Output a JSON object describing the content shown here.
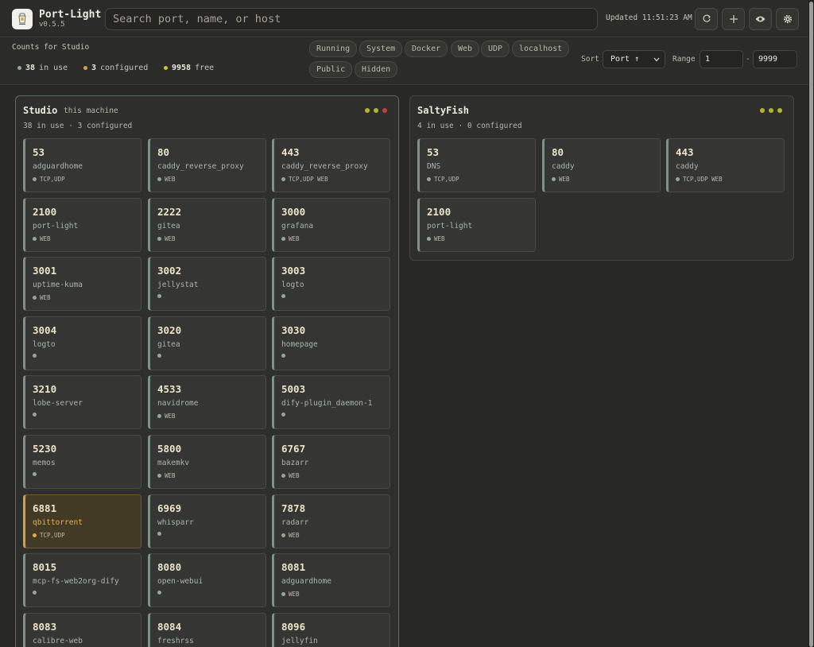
{
  "app": {
    "name": "Port-Light",
    "version": "v0.5.5"
  },
  "search": {
    "placeholder": "Search port, name, or host"
  },
  "updated": "Updated 11:51:23 AM",
  "toolbar": {
    "icons": [
      "refresh-icon",
      "plus-icon",
      "eye-icon",
      "gear-icon"
    ]
  },
  "counts": {
    "title": "Counts for Studio",
    "in_use_num": "38",
    "in_use_label": "in use",
    "configured_num": "3",
    "configured_label": "configured",
    "free_num": "9958",
    "free_label": "free"
  },
  "filters": [
    "Running",
    "System",
    "Docker",
    "Web",
    "UDP",
    "localhost",
    "Public",
    "Hidden"
  ],
  "sort": {
    "label": "Sort",
    "value": "Port ↑"
  },
  "range": {
    "label": "Range",
    "from": "1",
    "sep": "-",
    "to": "9999"
  },
  "colors": {
    "in_use": "#8fa89a",
    "configured": "#d6a33a",
    "free": "#c8c43a",
    "warning": "#d6a33a"
  },
  "hosts": [
    {
      "name": "Studio",
      "sub": "this machine",
      "meta": "38 in use · 3 configured",
      "status_dots": [
        "#b5b531",
        "#b5b531",
        "#b8453a"
      ],
      "ports": [
        {
          "port": "53",
          "name": "adguardhome",
          "tags": "TCP,UDP"
        },
        {
          "port": "80",
          "name": "caddy_reverse_proxy",
          "tags": "WEB"
        },
        {
          "port": "443",
          "name": "caddy_reverse_proxy",
          "tags": "TCP,UDP WEB"
        },
        {
          "port": "2100",
          "name": "port-light",
          "tags": "WEB"
        },
        {
          "port": "2222",
          "name": "gitea",
          "tags": "WEB"
        },
        {
          "port": "3000",
          "name": "grafana",
          "tags": "WEB"
        },
        {
          "port": "3001",
          "name": "uptime-kuma",
          "tags": "WEB"
        },
        {
          "port": "3002",
          "name": "jellystat",
          "tags": ""
        },
        {
          "port": "3003",
          "name": "logto",
          "tags": ""
        },
        {
          "port": "3004",
          "name": "logto",
          "tags": ""
        },
        {
          "port": "3020",
          "name": "gitea",
          "tags": ""
        },
        {
          "port": "3030",
          "name": "homepage",
          "tags": ""
        },
        {
          "port": "3210",
          "name": "lobe-server",
          "tags": ""
        },
        {
          "port": "4533",
          "name": "navidrome",
          "tags": "WEB"
        },
        {
          "port": "5003",
          "name": "dify-plugin_daemon-1",
          "tags": ""
        },
        {
          "port": "5230",
          "name": "memos",
          "tags": ""
        },
        {
          "port": "5800",
          "name": "makemkv",
          "tags": "WEB"
        },
        {
          "port": "6767",
          "name": "bazarr",
          "tags": "WEB"
        },
        {
          "port": "6881",
          "name": "qbittorrent",
          "tags": "TCP,UDP",
          "warning": true
        },
        {
          "port": "6969",
          "name": "whisparr",
          "tags": ""
        },
        {
          "port": "7878",
          "name": "radarr",
          "tags": "WEB"
        },
        {
          "port": "8015",
          "name": "mcp-fs-web2org-dify",
          "tags": ""
        },
        {
          "port": "8080",
          "name": "open-webui",
          "tags": ""
        },
        {
          "port": "8081",
          "name": "adguardhome",
          "tags": "WEB"
        },
        {
          "port": "8083",
          "name": "calibre-web",
          "tags": ""
        },
        {
          "port": "8084",
          "name": "freshrss",
          "tags": ""
        },
        {
          "port": "8096",
          "name": "jellyfin",
          "tags": ""
        }
      ]
    },
    {
      "name": "SaltyFish",
      "sub": "",
      "meta": "4 in use · 0 configured",
      "status_dots": [
        "#b5b531",
        "#b5b531",
        "#b5b531"
      ],
      "ports": [
        {
          "port": "53",
          "name": "DNS",
          "tags": "TCP,UDP"
        },
        {
          "port": "80",
          "name": "caddy",
          "tags": "WEB"
        },
        {
          "port": "443",
          "name": "caddy",
          "tags": "TCP,UDP WEB"
        },
        {
          "port": "2100",
          "name": "port-light",
          "tags": "WEB"
        }
      ]
    }
  ]
}
